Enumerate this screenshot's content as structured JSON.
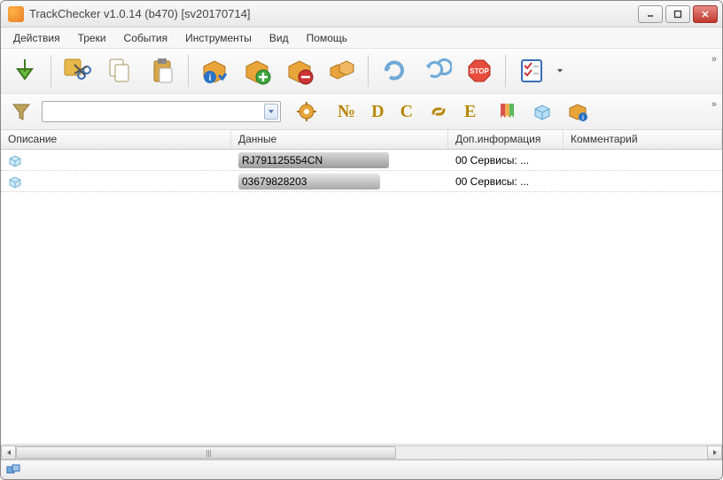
{
  "window": {
    "title": "TrackChecker v1.0.14 (b470)  [sv20170714]"
  },
  "menu": {
    "items": [
      "Действия",
      "Треки",
      "События",
      "Инструменты",
      "Вид",
      "Помощь"
    ]
  },
  "toolbar2": {
    "filter_value": "",
    "letters": {
      "no": "№",
      "d": "D",
      "c": "C",
      "e": "E"
    }
  },
  "columns": {
    "desc": "Описание",
    "data": "Данные",
    "extra": "Доп.информация",
    "comm": "Комментарий"
  },
  "rows": [
    {
      "desc": "",
      "data": "RJ791125554CN",
      "extra": "00 Сервисы: ...",
      "comm": ""
    },
    {
      "desc": "",
      "data": "03679828203",
      "extra": "00 Сервисы: ...",
      "comm": ""
    }
  ]
}
